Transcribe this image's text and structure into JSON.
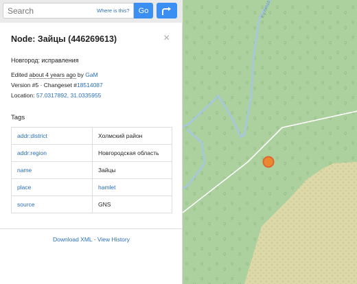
{
  "search": {
    "placeholder": "Search",
    "where_link": "Where is this?",
    "go_label": "Go"
  },
  "node": {
    "title": "Node: Зайцы (446269613)",
    "comment": "Новгород: исправления",
    "edited_prefix": "Edited ",
    "edited_time": "about 4 years ago",
    "edited_by": " by ",
    "editor": "GaM",
    "version_text": "Version #5 · Changeset #",
    "changeset": "18514087",
    "location_prefix": "Location: ",
    "location": "57.0317892, 31.0335955"
  },
  "tags": {
    "heading": "Tags",
    "rows": [
      {
        "key": "addr:district",
        "value": "Холмский район",
        "link": false
      },
      {
        "key": "addr:region",
        "value": "Новгородская область",
        "link": false
      },
      {
        "key": "name",
        "value": "Зайцы",
        "link": false
      },
      {
        "key": "place",
        "value": "hamlet",
        "link": true
      },
      {
        "key": "source",
        "value": "GNS",
        "link": false
      }
    ]
  },
  "footer": {
    "download_xml": "Download XML",
    "separator": " · ",
    "view_history": "View History"
  },
  "map": {
    "river_label": "Кулица",
    "colors": {
      "forest": "#add19e",
      "river": "#a6c8d8",
      "marker": "#f57c1f",
      "wetland": "#dfd8a6"
    }
  }
}
